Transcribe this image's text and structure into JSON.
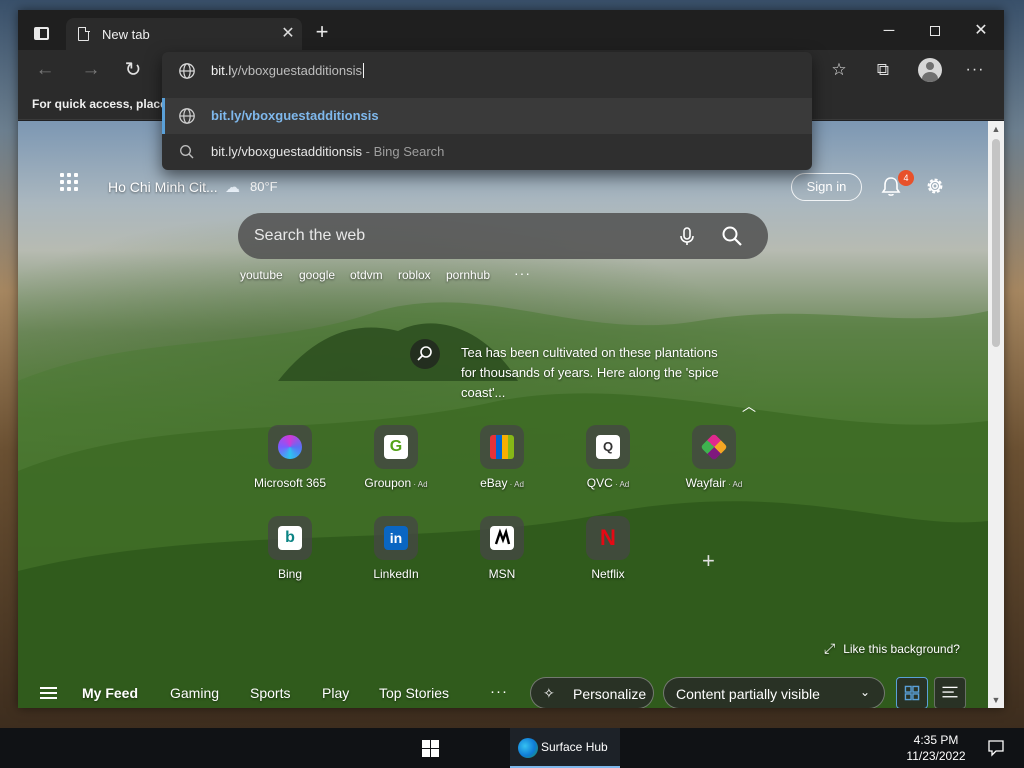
{
  "tabstrip": {
    "tab_title": "New tab",
    "close_glyph": "✕",
    "new_tab_glyph": "+"
  },
  "window_controls": {
    "minimize": "─",
    "close": "✕"
  },
  "toolbar": {
    "back_glyph": "←",
    "forward_glyph": "→",
    "reload_glyph": "↻",
    "favorites_glyph": "☆",
    "collections_glyph": "⧉",
    "more_glyph": "···"
  },
  "favorites_bar": {
    "message": "For quick access, place y"
  },
  "omnibox": {
    "typed_text": "bit.l",
    "autocomplete_text": "y/vboxguestadditionsis",
    "suggestions": [
      {
        "text": "bit.ly/vboxguestadditionsis",
        "suffix": ""
      },
      {
        "text": "bit.ly/vboxguestadditionsis",
        "suffix": " - Bing Search"
      }
    ]
  },
  "header": {
    "location": "Ho Chi Minh Cit...",
    "weather_icon": "☁",
    "temperature": "80°F",
    "sign_in": "Sign in",
    "notification_count": "4"
  },
  "search": {
    "placeholder": "Search the web",
    "quick_links": [
      "youtube",
      "google",
      "otdvm",
      "roblox",
      "pornhub"
    ],
    "more_glyph": "···"
  },
  "background_info": {
    "text": "Tea has been cultivated on these plantations for thousands of years. Here along the 'spice coast'...",
    "collapse_glyph": "︿",
    "like_text": "Like this background?",
    "like_glyph": "⤢"
  },
  "tiles": [
    {
      "label": "Microsoft 365",
      "ad": "",
      "logo": "",
      "logo_color": "#7b5cff",
      "logo_bg": "#7b5cff"
    },
    {
      "label": "Groupon",
      "ad": " · Ad",
      "logo": "G",
      "logo_color": "#53a318",
      "logo_bg": "#ffffff"
    },
    {
      "label": "eBay",
      "ad": " · Ad",
      "logo": "",
      "logo_color": "#e53238",
      "logo_bg": "#e53238"
    },
    {
      "label": "QVC",
      "ad": " · Ad",
      "logo": "Q",
      "logo_color": "#333333",
      "logo_bg": "#ffffff"
    },
    {
      "label": "Wayfair",
      "ad": " · Ad",
      "logo": "",
      "logo_color": "#7f187f",
      "logo_bg": "#7f187f"
    },
    {
      "label": "Bing",
      "ad": "",
      "logo": "b",
      "logo_color": "#0c8484",
      "logo_bg": "#ffffff"
    },
    {
      "label": "LinkedIn",
      "ad": "",
      "logo": "in",
      "logo_color": "#ffffff",
      "logo_bg": "#0a66c2"
    },
    {
      "label": "MSN",
      "ad": "",
      "logo": "",
      "logo_color": "#000000",
      "logo_bg": "#ffffff"
    },
    {
      "label": "Netflix",
      "ad": "",
      "logo": "N",
      "logo_color": "#e50914",
      "logo_bg": "#111111"
    }
  ],
  "add_tile_glyph": "+",
  "feed": {
    "tabs": [
      "My Feed",
      "Gaming",
      "Sports",
      "Play",
      "Top Stories"
    ],
    "more_glyph": "···",
    "personalize": "Personalize",
    "personalize_glyph": "✧",
    "content_visibility": "Content partially visible",
    "chevron_glyph": "⌄"
  },
  "taskbar": {
    "app_name": "Surface Hub",
    "time": "4:35 PM",
    "date": "11/23/2022"
  }
}
